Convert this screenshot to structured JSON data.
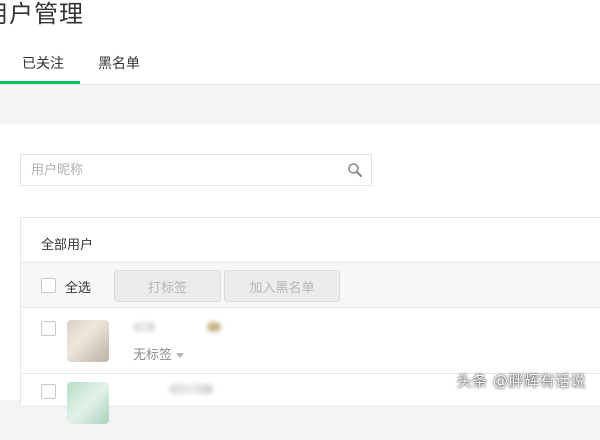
{
  "page": {
    "title": "用户管理"
  },
  "tabs": [
    {
      "label": "已关注",
      "active": true
    },
    {
      "label": "黑名单",
      "active": false
    }
  ],
  "search": {
    "placeholder": "用户昵称",
    "value": ""
  },
  "panel": {
    "title": "全部用户",
    "toolbar": {
      "select_all_label": "全选",
      "tag_button_label": "打标签",
      "blacklist_button_label": "加入黑名单"
    },
    "users": [
      {
        "tag_label": "无标签"
      },
      {
        "tag_label": ""
      }
    ]
  },
  "watermark": "头条 @胖辉有话说",
  "colors": {
    "accent": "#07c160",
    "background": "#f3f4f6"
  }
}
